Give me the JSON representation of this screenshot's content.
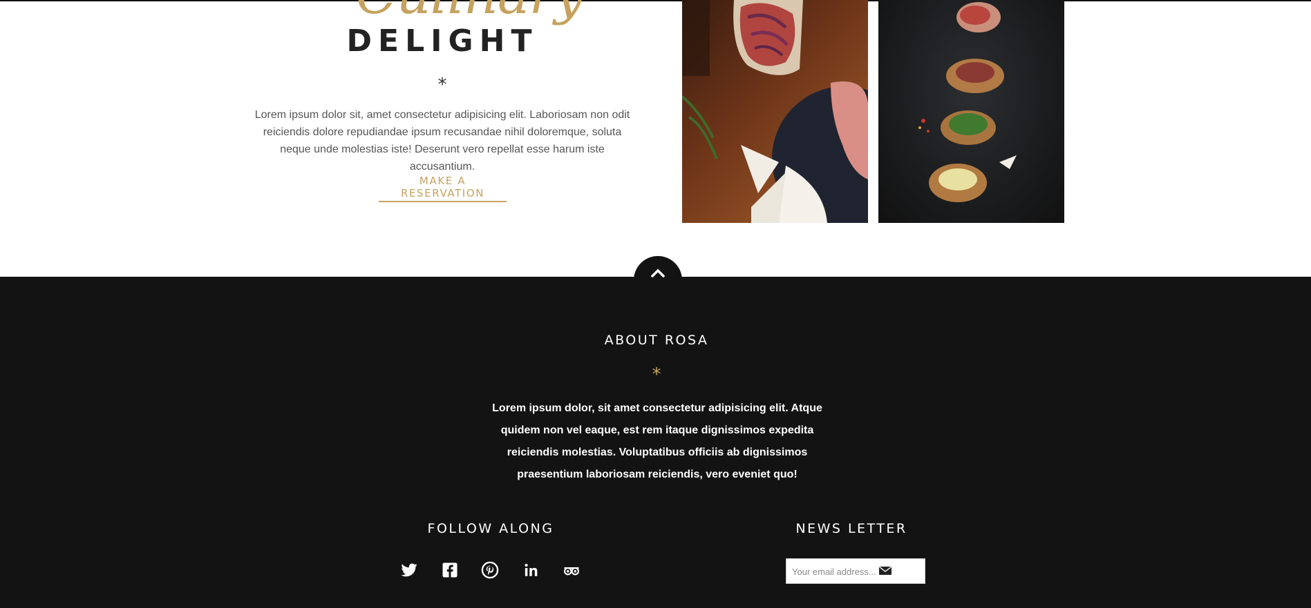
{
  "hero": {
    "script_title": "Culinary",
    "title": "DELIGHT",
    "star": "*",
    "intro": "Lorem ipsum dolor sit, amet consectetur adipisicing elit. Laboriosam non odit reiciendis dolore repudiandae ipsum recusandae nihil doloremque, soluta neque unde molestias iste! Deserunt vero repellat esse harum iste accusantium.",
    "cta": "MAKE A RESERVATION"
  },
  "footer": {
    "about_title": "ABOUT ROSA",
    "star": "*",
    "about_text": "Lorem ipsum dolor, sit amet consectetur adipisicing elit. Atque quidem non vel eaque, est rem itaque dignissimos expedita reiciendis molestias. Voluptatibus officiis ab dignissimos praesentium laboriosam reiciendis, vero eveniet quo!",
    "follow_title": "FOLLOW ALONG",
    "social_icons": [
      "twitter-icon",
      "facebook-icon",
      "pinterest-icon",
      "linkedin-icon",
      "tripadvisor-icon"
    ],
    "newsletter_title": "NEWS LETTER",
    "email_placeholder": "Your email address..."
  },
  "colors": {
    "accent": "#c6a25f",
    "footer_bg": "#131313",
    "heading_dark": "#222222"
  }
}
